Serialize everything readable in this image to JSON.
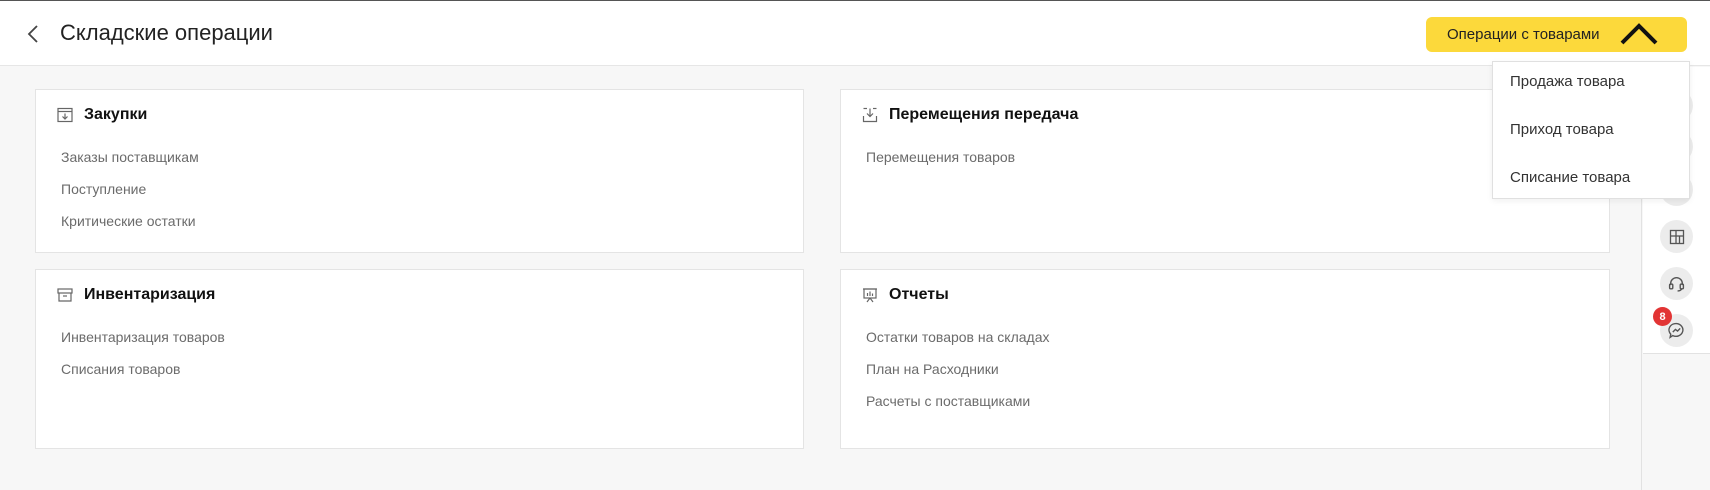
{
  "header": {
    "title": "Складские операции",
    "ops_button_label": "Операции с товарами"
  },
  "dropdown": {
    "items": [
      "Продажа товара",
      "Приход товара",
      "Списание товара"
    ]
  },
  "cards": [
    {
      "title": "Закупки",
      "icon": "archive-in-icon",
      "links": [
        "Заказы поставщикам",
        "Поступление",
        "Критические остатки"
      ]
    },
    {
      "title": "Перемещения передача",
      "icon": "download-box-icon",
      "links": [
        "Перемещения товаров"
      ]
    },
    {
      "title": "Инвентаризация",
      "icon": "archive-box-icon",
      "links": [
        "Инвентаризация товаров",
        "Списания товаров"
      ]
    },
    {
      "title": "Отчеты",
      "icon": "presentation-chart-icon",
      "links": [
        "Остатки товаров на складах",
        "План на Расходники",
        "Расчеты с поставщиками"
      ]
    }
  ],
  "rail": {
    "buttons": [
      "dashboard-icon",
      "headset-icon",
      "messenger-icon"
    ],
    "badge_count": "8"
  },
  "colors": {
    "accent": "#fcd93b",
    "badge": "#e23434",
    "link": "#6b6b6b"
  }
}
